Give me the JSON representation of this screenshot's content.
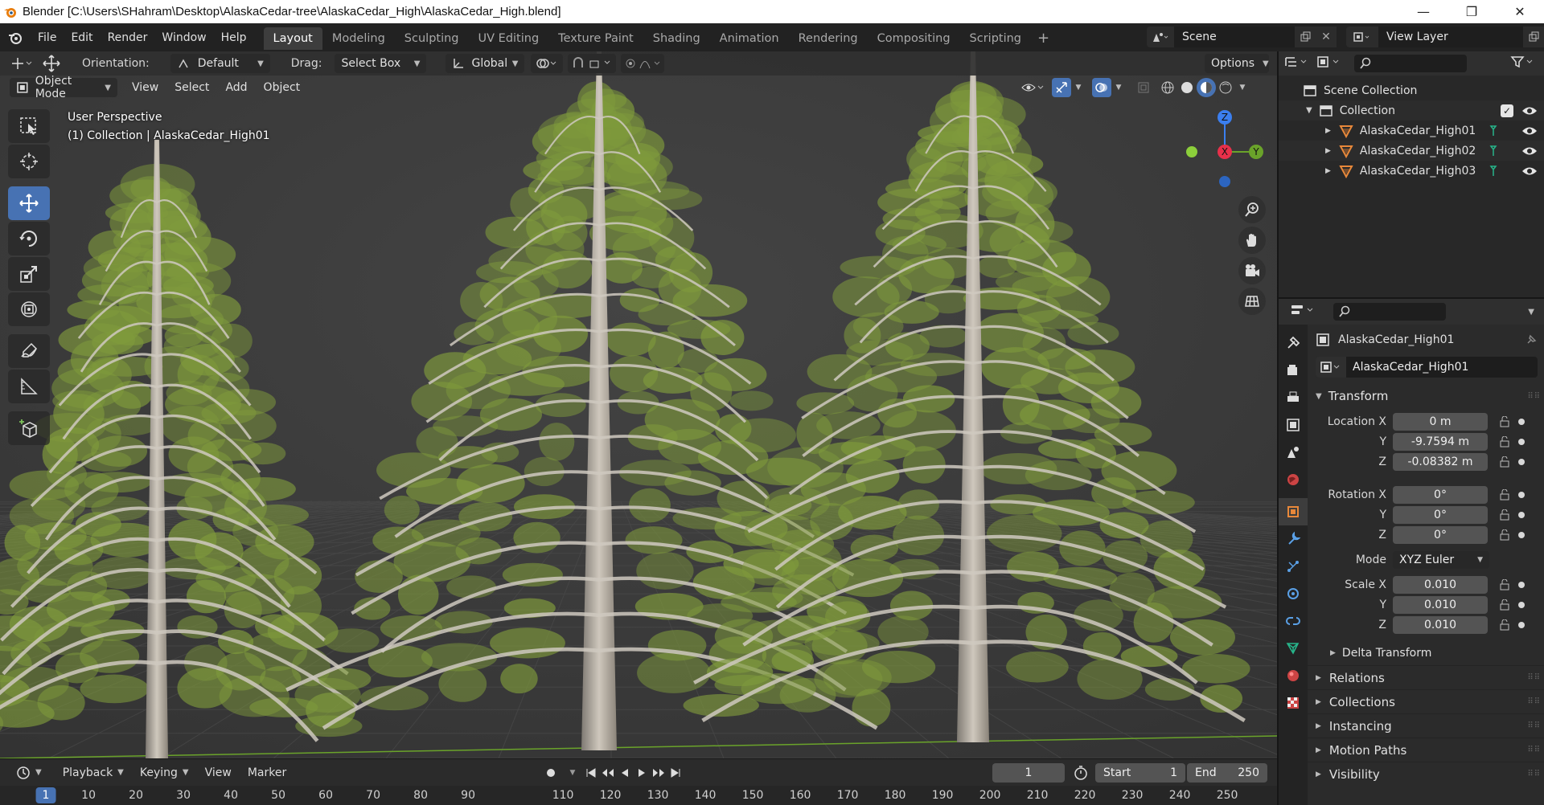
{
  "window": {
    "title": "Blender [C:\\Users\\SHahram\\Desktop\\AlaskaCedar-tree\\AlaskaCedar_High\\AlaskaCedar_High.blend]",
    "controls": [
      "—",
      "❐",
      "✕"
    ]
  },
  "menus": [
    "File",
    "Edit",
    "Render",
    "Window",
    "Help"
  ],
  "workspaces": [
    "Layout",
    "Modeling",
    "Sculpting",
    "UV Editing",
    "Texture Paint",
    "Shading",
    "Animation",
    "Rendering",
    "Compositing",
    "Scripting"
  ],
  "workspace_add": "+",
  "active_workspace": "Layout",
  "scene": {
    "name": "Scene"
  },
  "view_layer": {
    "name": "View Layer"
  },
  "tool_header": {
    "orientation_label": "Orientation:",
    "orientation_value": "Default",
    "drag_label": "Drag:",
    "drag_value": "Select Box",
    "transform_orientation": "Global",
    "options_label": "Options"
  },
  "viewport_header": {
    "mode": "Object Mode",
    "menus": [
      "View",
      "Select",
      "Add",
      "Object"
    ]
  },
  "viewport": {
    "perspective_label": "User Perspective",
    "collection_label": "(1) Collection | AlaskaCedar_High01",
    "axes": {
      "x": "X",
      "y": "Y",
      "z": "Z"
    }
  },
  "toolbar_tools": [
    "select-box",
    "cursor",
    "move",
    "rotate",
    "scale",
    "transform",
    "annotate",
    "measure",
    "add-cube"
  ],
  "outliner": {
    "root": "Scene Collection",
    "collection": "Collection",
    "objects": [
      "AlaskaCedar_High01",
      "AlaskaCedar_High02",
      "AlaskaCedar_High03"
    ]
  },
  "properties": {
    "object_name": "AlaskaCedar_High01",
    "name_field": "AlaskaCedar_High01",
    "transform_title": "Transform",
    "location_label": "Location X",
    "location": [
      "0 m",
      "-9.7594 m",
      "-0.08382 m"
    ],
    "rotation_label": "Rotation X",
    "rotation": [
      "0°",
      "0°",
      "0°"
    ],
    "mode_label": "Mode",
    "mode_value": "XYZ Euler",
    "scale_label": "Scale X",
    "scale": [
      "0.010",
      "0.010",
      "0.010"
    ],
    "y_label": "Y",
    "z_label": "Z",
    "delta_transform": "Delta Transform",
    "panels": [
      "Relations",
      "Collections",
      "Instancing",
      "Motion Paths",
      "Visibility"
    ]
  },
  "timeline": {
    "menus": [
      "Playback",
      "Keying",
      "View",
      "Marker"
    ],
    "current_frame": "1",
    "start_label": "Start",
    "start": "1",
    "end_label": "End",
    "end": "250",
    "ruler_current": "1",
    "ruler_ticks": [
      "10",
      "20",
      "30",
      "40",
      "50",
      "60",
      "70",
      "80",
      "90",
      "110",
      "120",
      "130",
      "140",
      "150",
      "160",
      "170",
      "180",
      "190",
      "200",
      "210",
      "220",
      "230",
      "240",
      "250"
    ]
  },
  "colors": {
    "accent": "#4772b3",
    "axis_x": "#e8304a",
    "axis_y": "#6aa32a",
    "axis_z": "#3b7ff0",
    "foliage": "#7f9a3c",
    "object_orange": "#e8883a"
  }
}
